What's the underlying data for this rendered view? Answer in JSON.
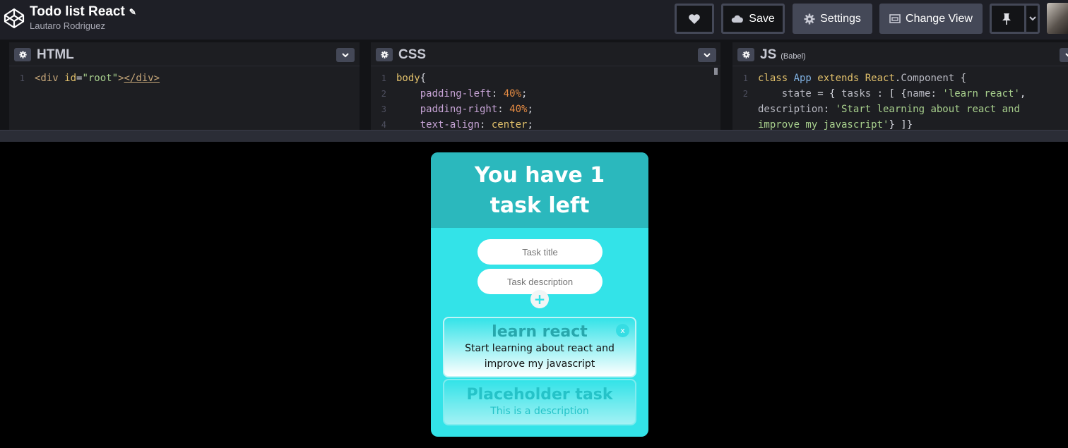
{
  "header": {
    "title": "Todo list React",
    "author": "Lautaro Rodriguez",
    "buttons": {
      "save": "Save",
      "settings": "Settings",
      "change_view": "Change View"
    }
  },
  "editors": {
    "html": {
      "label": "HTML",
      "lines": [
        "1"
      ]
    },
    "css": {
      "label": "CSS",
      "lines": [
        "1",
        "2",
        "3",
        "4"
      ]
    },
    "js": {
      "label": "JS",
      "sub": "(Babel)",
      "lines": [
        "1",
        "2"
      ]
    }
  },
  "preview": {
    "heading": "You have 1 task left",
    "title_placeholder": "Task title",
    "description_placeholder": "Task description",
    "add_label": "+",
    "remove_label": "x",
    "tasks": [
      {
        "name": "learn react",
        "description": "Start learning about react and improve my javascript"
      },
      {
        "name": "Placeholder task",
        "description": "This is a description"
      }
    ]
  },
  "colors": {
    "accent_dark": "#2bb8bd",
    "accent": "#33e3e8",
    "toolbar": "#1e1f26",
    "button": "#444857"
  },
  "icons": [
    "codepen-logo-icon",
    "pencil-icon",
    "heart-icon",
    "cloud-icon",
    "gear-icon",
    "window-icon",
    "pin-icon",
    "chevron-down-icon"
  ]
}
